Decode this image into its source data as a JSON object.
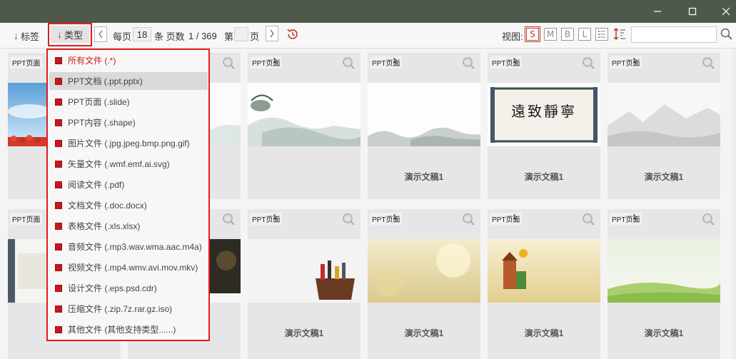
{
  "toolbar": {
    "tag_label": "标签",
    "type_label": "类型",
    "per_page_label": "每页",
    "per_page_value": "18",
    "items_label": "条 页数",
    "page_info": "1 / 369",
    "goto_prefix": "第",
    "goto_value": "",
    "goto_suffix": "页",
    "view_label": "视图:",
    "view_buttons": [
      "S",
      "M",
      "B",
      "L"
    ],
    "search_value": ""
  },
  "cards_row1": [
    {
      "tag": "PPT页面",
      "count": "",
      "title": ""
    },
    {
      "tag": "",
      "count": "",
      "title": ""
    },
    {
      "tag": "PPT页面",
      "count": "1",
      "title": ""
    },
    {
      "tag": "PPT页面",
      "count": "1",
      "title": "演示文稿1"
    },
    {
      "tag": "PPT页面",
      "count": "1",
      "title": "演示文稿1"
    },
    {
      "tag": "PPT页面",
      "count": "1",
      "title": "演示文稿1"
    }
  ],
  "cards_row2": [
    {
      "tag": "PPT页面",
      "count": "",
      "title": ""
    },
    {
      "tag": "",
      "count": "",
      "title": ""
    },
    {
      "tag": "PPT页面",
      "count": "1",
      "title": "演示文稿1"
    },
    {
      "tag": "PPT页面",
      "count": "1",
      "title": "演示文稿1"
    },
    {
      "tag": "PPT页面",
      "count": "1",
      "title": "演示文稿1"
    },
    {
      "tag": "PPT页面",
      "count": "1",
      "title": "演示文稿1"
    }
  ],
  "calligraphy_text": "遠致靜寧",
  "dropdown": {
    "items": [
      "所有文件 (.*)",
      "PPT文档 (.ppt.pptx)",
      "PPT页面 (.slide)",
      "PPT内容 (.shape)",
      "图片文件 (.jpg.jpeg.bmp.png.gif)",
      "矢量文件 (.wmf.emf.ai.svg)",
      "阅读文件 (.pdf)",
      "文档文件 (.doc.docx)",
      "表格文件 (.xls.xlsx)",
      "音频文件 (.mp3.wav.wma.aac.m4a)",
      "视频文件 (.mp4.wmv.avi.mov.mkv)",
      "设计文件 (.eps.psd.cdr)",
      "压缩文件 (.zip.7z.rar.gz.iso)",
      "其他文件 (其他支持类型......)"
    ],
    "selected_index": 0,
    "hover_index": 1
  },
  "colors": {
    "titlebar": "#4e594c",
    "accent_red": "#e11d1d",
    "check_red": "#c8161d"
  }
}
